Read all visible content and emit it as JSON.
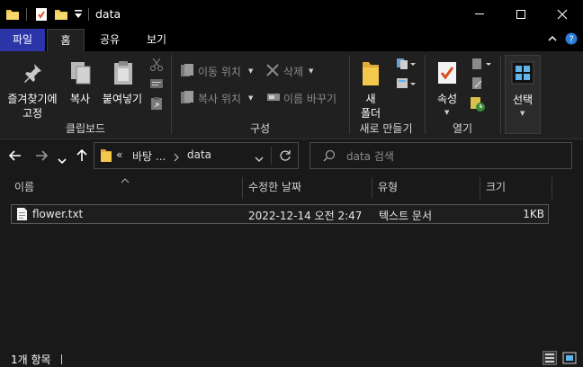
{
  "window": {
    "title": "data"
  },
  "tabs": [
    "파일",
    "홈",
    "공유",
    "보기"
  ],
  "ribbon": {
    "clipboard": {
      "pin_label_line1": "즐겨찾기에",
      "pin_label_line2": "고정",
      "copy_label": "복사",
      "paste_label": "붙여넣기",
      "group_label": "클립보드"
    },
    "organize": {
      "move_to": "이동 위치",
      "copy_to": "복사 위치",
      "delete": "삭제",
      "rename": "이름 바꾸기",
      "group_label": "구성"
    },
    "new": {
      "new_folder_line1": "새",
      "new_folder_line2": "폴더",
      "group_label": "새로 만들기"
    },
    "open": {
      "properties": "속성",
      "group_label": "열기"
    },
    "select": {
      "select_label": "선택"
    }
  },
  "address": {
    "overflow": "«",
    "crumbs": [
      "바탕 ...",
      "data"
    ]
  },
  "search": {
    "placeholder": "data 검색"
  },
  "columns": {
    "name": "이름",
    "modified": "수정한 날짜",
    "type": "유형",
    "size": "크기"
  },
  "files": [
    {
      "name": "flower.txt",
      "modified": "2022-12-14 오전 2:47",
      "type": "텍스트 문서",
      "size": "1KB"
    }
  ],
  "status": {
    "count_text": "1개 항목"
  },
  "colors": {
    "file_tab": "#2b35a8",
    "background": "#191919",
    "ribbon": "#202020",
    "accent_blue": "#5fb4f0"
  }
}
